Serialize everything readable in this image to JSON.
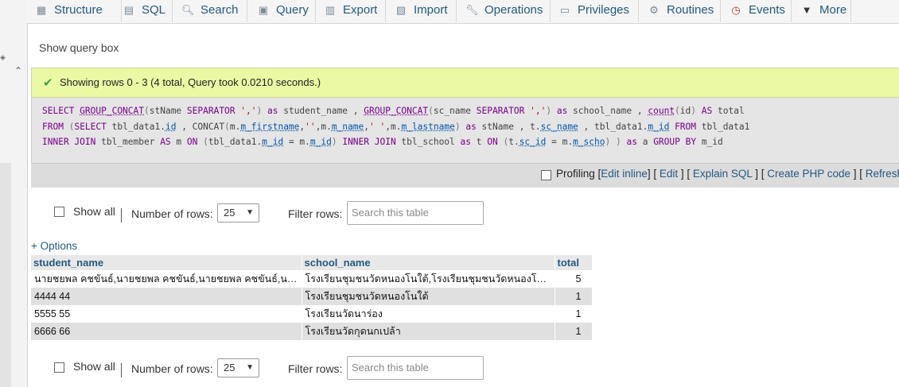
{
  "tabs": [
    {
      "label": "Structure",
      "icon": "structure-icon"
    },
    {
      "label": "SQL",
      "icon": "sql-icon"
    },
    {
      "label": "Search",
      "icon": "search-icon"
    },
    {
      "label": "Query",
      "icon": "query-icon"
    },
    {
      "label": "Export",
      "icon": "export-icon"
    },
    {
      "label": "Import",
      "icon": "import-icon"
    },
    {
      "label": "Operations",
      "icon": "wrench-icon"
    },
    {
      "label": "Privileges",
      "icon": "privileges-icon"
    },
    {
      "label": "Routines",
      "icon": "routines-icon"
    },
    {
      "label": "Events",
      "icon": "clock-icon"
    },
    {
      "label": "More",
      "icon": "triangle-down-icon"
    }
  ],
  "show_query_box": "Show query box",
  "success_message": "Showing rows 0 - 3 (4 total, Query took 0.0210 seconds.)",
  "sql": {
    "line1": "SELECT GROUP_CONCAT(stName SEPARATOR ',') as student_name , GROUP_CONCAT(sc_name SEPARATOR ',') as school_name , count(id) AS total",
    "line2": "FROM (SELECT tbl_data1.id , CONCAT(m.m_firstname,'',m.m_name,' ',m.m_lastname) as stName , t.sc_name , tbl_data1.m_id FROM tbl_data1",
    "line3": "INNER JOIN tbl_member AS m ON (tbl_data1.m_id = m.m_id) INNER JOIN tbl_school as t ON (t.sc_id = m.m_scho) ) as a GROUP BY m_id"
  },
  "tools": {
    "profiling": "Profiling",
    "edit_inline": "Edit inline",
    "edit": "Edit",
    "explain_sql": "Explain SQL",
    "create_php_code": "Create PHP code",
    "refresh": "Refresh"
  },
  "controls": {
    "show_all": "Show all",
    "number_of_rows_label": "Number of rows:",
    "number_of_rows_value": "25",
    "filter_rows_label": "Filter rows:",
    "filter_placeholder": "Search this table"
  },
  "options_link": "+ Options",
  "table": {
    "headers": [
      "student_name",
      "school_name",
      "total"
    ],
    "rows": [
      [
        "นายชยพล คชขันธ์,นายชยพล คชขันธ์,นายชยพล คชขันธ์,นา…",
        "โรงเรียนชุมชนวัดหนองโนใต้,โรงเรียนชุมชนวัดหนองโนใต…",
        "5"
      ],
      [
        "4444 44",
        "โรงเรียนชุมชนวัดหนองโนใต้",
        "1"
      ],
      [
        "5555 55",
        "โรงเรียนวัดนาร่อง",
        "1"
      ],
      [
        "6666 66",
        "โรงเรียนวัดกุดนกเปล้า",
        "1"
      ]
    ]
  }
}
